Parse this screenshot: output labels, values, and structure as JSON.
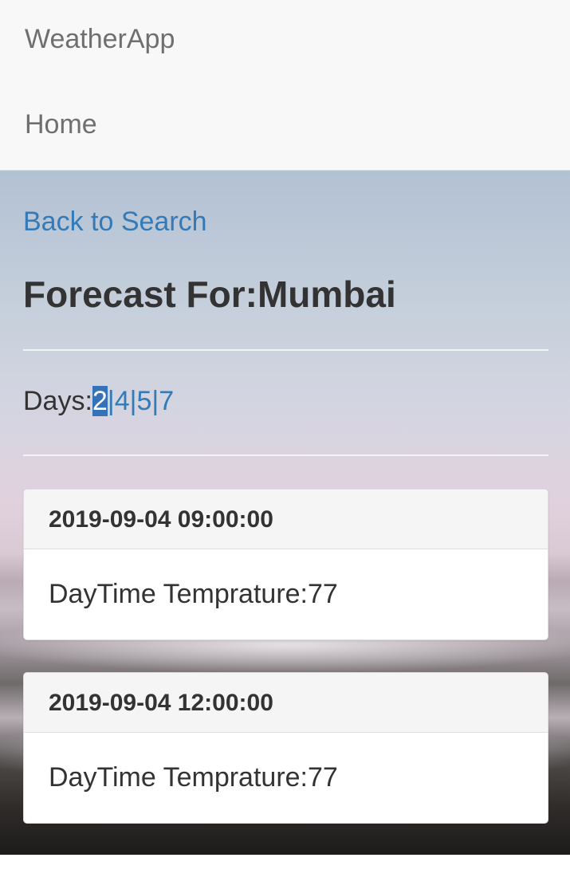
{
  "navbar": {
    "brand": "WeatherApp",
    "home": "Home"
  },
  "back_link": "Back to Search",
  "title": "Forecast For:Mumbai",
  "days": {
    "label": "Days:",
    "options": [
      "2",
      "4",
      "5",
      "7"
    ],
    "separator": "|",
    "selected": "2"
  },
  "forecasts": [
    {
      "datetime": "2019-09-04 09:00:00",
      "text": "DayTime Temprature:77"
    },
    {
      "datetime": "2019-09-04 12:00:00",
      "text": "DayTime Temprature:77"
    }
  ],
  "colors": {
    "link": "#337ab7",
    "selection": "#3672b8",
    "navbar_bg": "#f8f8f8",
    "text": "#333333"
  }
}
